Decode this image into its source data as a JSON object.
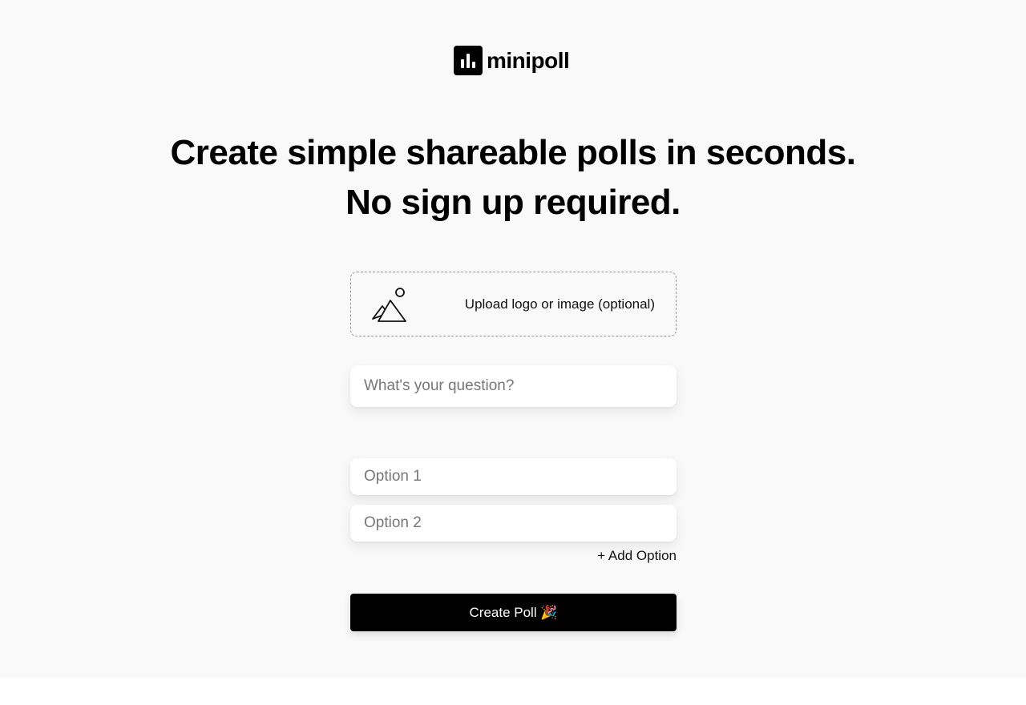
{
  "brand": {
    "name": "minipoll",
    "icon": "bar-chart-logo-icon"
  },
  "headline": {
    "line1": "Create simple shareable polls in seconds.",
    "line2": "No sign up required."
  },
  "upload": {
    "label": "Upload logo or image (optional)",
    "icon": "image-mountains-icon"
  },
  "question": {
    "placeholder": "What's your question?",
    "value": ""
  },
  "options": [
    {
      "placeholder": "Option 1",
      "value": ""
    },
    {
      "placeholder": "Option 2",
      "value": ""
    }
  ],
  "add_option_label": "+ Add Option",
  "create_button_label": "Create Poll 🎉",
  "colors": {
    "accent": "#000000",
    "background": "#f9f9f9",
    "placeholder": "#777777"
  }
}
